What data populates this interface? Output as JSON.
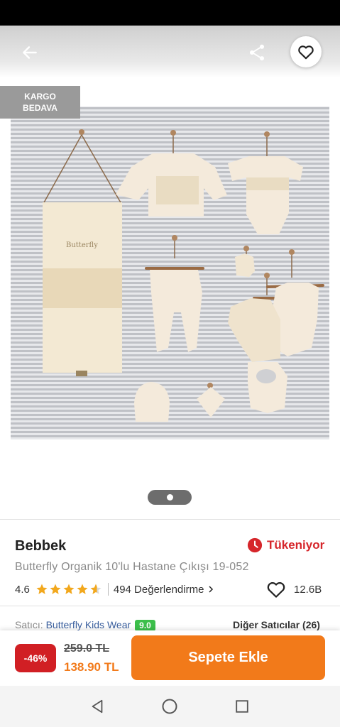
{
  "badges": {
    "cargo_line1": "KARGO",
    "cargo_line2": "BEDAVA"
  },
  "product": {
    "brand": "Bebbek",
    "stock_status": "Tükeniyor",
    "title": "Butterfly Organik 10'lu Hastane Çıkışı 19-052",
    "rating": "4.6",
    "rating_stars": 4.6,
    "reviews_label": "494 Değerlendirme",
    "favorite_count": "12.6B"
  },
  "carousel": {
    "current": 1,
    "total": 1
  },
  "seller": {
    "prefix": "Satıcı: ",
    "name": "Butterfly Kids Wear",
    "score": "9.0",
    "other_sellers": "Diğer Satıcılar (26)"
  },
  "purchase": {
    "discount": "-46%",
    "old_price": "259.0 TL",
    "new_price": "138.90 TL",
    "add_to_cart": "Sepete Ekle"
  },
  "colors": {
    "accent": "#f27a1a",
    "discount": "#d11f24",
    "stock": "#d6262b",
    "star": "#f2a81d",
    "badge": "#9a9a9a"
  },
  "icons": {
    "back": "arrow-left-icon",
    "share": "share-icon",
    "favorite": "heart-icon",
    "stock": "clock-icon",
    "star": "star-icon",
    "nav_back": "triangle-back-icon",
    "nav_home": "circle-home-icon",
    "nav_recent": "square-recent-icon"
  }
}
